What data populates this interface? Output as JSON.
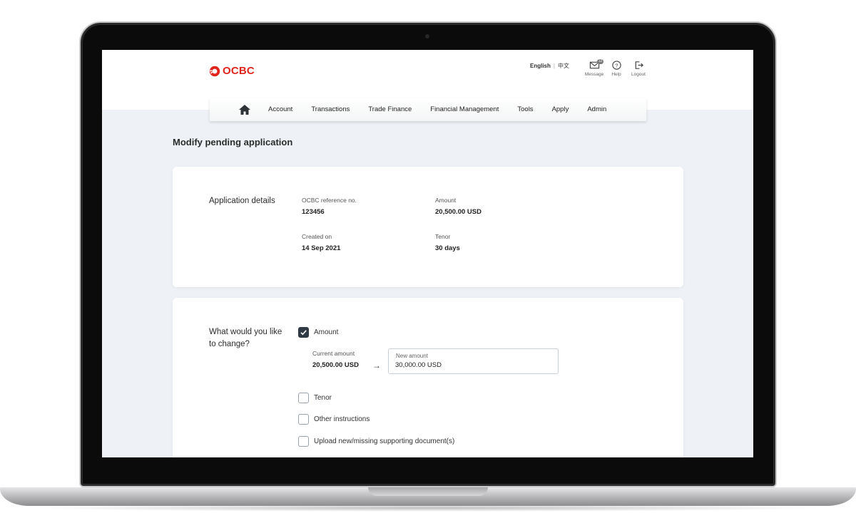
{
  "brand": {
    "name": "OCBC",
    "color": "#e0241b",
    "icon": "ocbc-logo-icon"
  },
  "header": {
    "lang_en": "English",
    "lang_separator": "|",
    "lang_zh": "中文",
    "message_label": "Message",
    "message_badge": "12",
    "help_label": "Help",
    "logout_label": "Logout"
  },
  "nav": {
    "home_icon": "home-icon",
    "items": [
      "Account",
      "Transactions",
      "Trade Finance",
      "Financial Management",
      "Tools",
      "Apply",
      "Admin"
    ]
  },
  "page": {
    "title": "Modify pending application"
  },
  "application": {
    "section_label": "Application details",
    "ref_label": "OCBC reference no.",
    "ref_value": "123456",
    "amount_label": "Amount",
    "amount_value": "20,500.00 USD",
    "created_label": "Created on",
    "created_value": "14 Sep 2021",
    "tenor_label": "Tenor",
    "tenor_value": "30 days"
  },
  "change": {
    "section_label_line1": "What would you like",
    "section_label_line2": "to change?",
    "options": [
      {
        "label": "Amount",
        "checked": true
      },
      {
        "label": "Tenor",
        "checked": false
      },
      {
        "label": "Other instructions",
        "checked": false
      },
      {
        "label": "Upload new/missing supporting document(s)",
        "checked": false
      }
    ],
    "current_amount_label": "Current amount",
    "current_amount_value": "20,500.00 USD",
    "arrow": "→",
    "new_amount_label": "New amount",
    "new_amount_value": "30,000.00 USD"
  }
}
